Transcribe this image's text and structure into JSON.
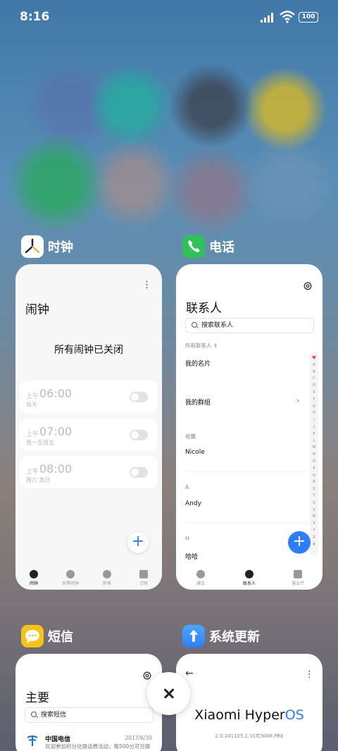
{
  "status": {
    "time": "8:16",
    "battery": "100"
  },
  "apps": {
    "clock": {
      "name": "时钟",
      "title": "闹钟",
      "message": "所有闹钟已关闭",
      "alarms": [
        {
          "ampm": "上午",
          "time": "06:00",
          "days": "每天"
        },
        {
          "ampm": "上午",
          "time": "07:00",
          "days": "周一至周五"
        },
        {
          "ampm": "上午",
          "time": "08:00",
          "days": "周六 周日"
        }
      ],
      "nav": [
        "闹钟",
        "世界时钟",
        "秒表",
        "计时"
      ]
    },
    "phone": {
      "name": "电话",
      "title": "联系人",
      "search_placeholder": "搜索联系人",
      "all_contacts": "所有联系人 ⇕",
      "my_card": "我的名片",
      "my_groups": "我的群组",
      "favorites_label": "收藏",
      "fav_contact": "Nicole",
      "section_a": "A",
      "contact_a": "Andy",
      "section_h": "H",
      "contact_h": "哈哈",
      "alphabet": [
        "♥",
        "A",
        "B",
        "C",
        "D",
        "E",
        "F",
        "G",
        "H",
        "I",
        "J",
        "K",
        "L",
        "M",
        "N",
        "O",
        "P",
        "Q",
        "R",
        "S",
        "T",
        "U",
        "V",
        "W",
        "X",
        "Y",
        "Z",
        "#"
      ],
      "nav": [
        "通话",
        "联系人",
        "营业厅"
      ]
    },
    "sms": {
      "name": "短信",
      "title": "主要",
      "search_placeholder": "搜索短信",
      "message": {
        "sender": "中国电信",
        "date": "2017/6/30",
        "preview": "欢迎参加积分兑换话费活动，每500分可兑换"
      }
    },
    "update": {
      "name": "系统更新",
      "brand_a": "Xiaomi Hyper",
      "brand_b": "OS",
      "version": "2.0.241105.1.VLTCNXM.PRE"
    }
  }
}
